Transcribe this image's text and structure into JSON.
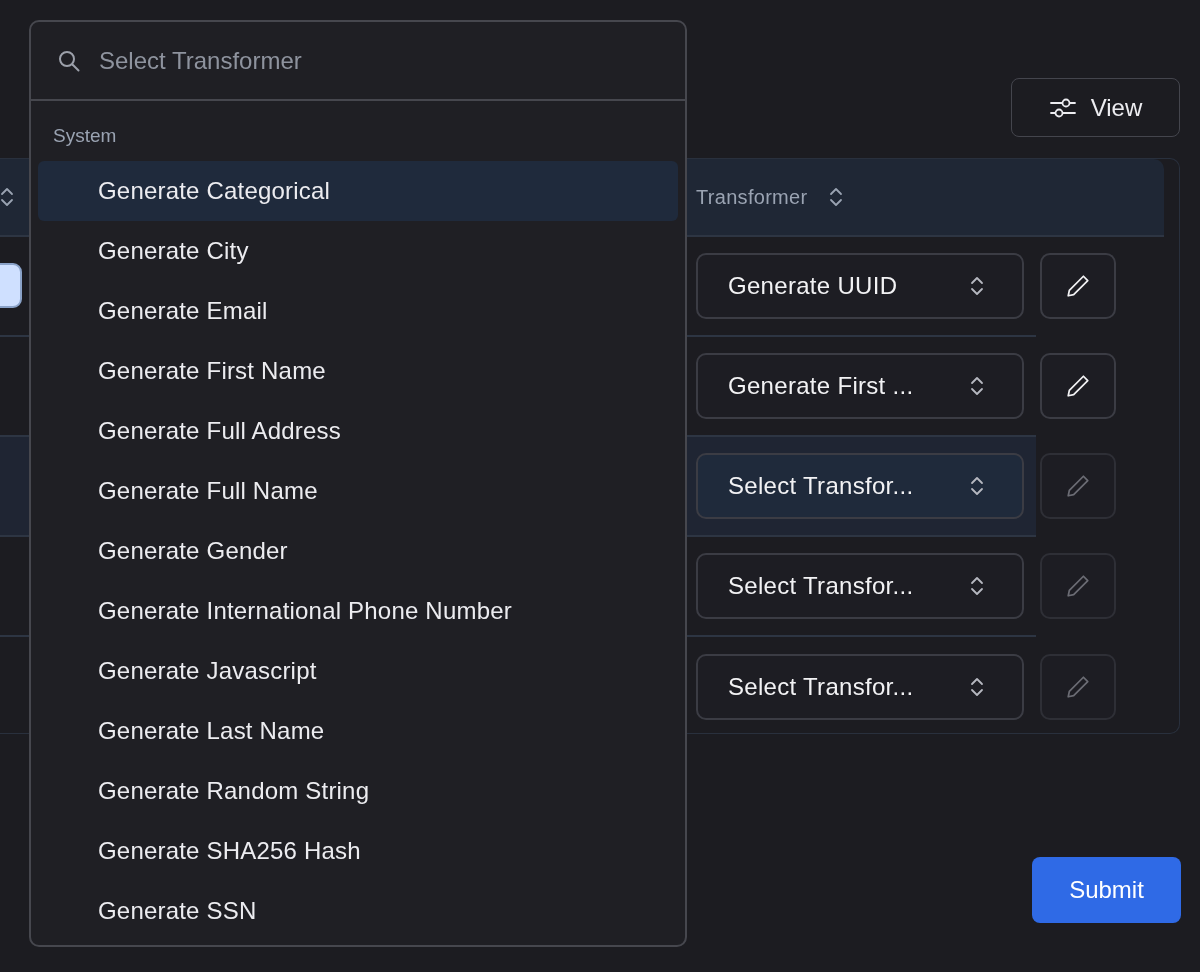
{
  "view_button": {
    "label": "View"
  },
  "table": {
    "column_header": "Transformer",
    "rows": [
      {
        "partial_button": true,
        "highlighted": false,
        "transformer": "Generate UUID",
        "edit_disabled": false
      },
      {
        "partial_button": false,
        "highlighted": false,
        "transformer": "Generate First ...",
        "edit_disabled": false
      },
      {
        "partial_button": false,
        "highlighted": true,
        "transformer": "Select Transfor...",
        "edit_disabled": true
      },
      {
        "partial_button": false,
        "highlighted": false,
        "transformer": "Select Transfor...",
        "edit_disabled": true
      },
      {
        "partial_button": false,
        "highlighted": false,
        "transformer": "Select Transfor...",
        "edit_disabled": true
      }
    ]
  },
  "submit_button": {
    "label": "Submit"
  },
  "transformer_menu": {
    "search": {
      "placeholder": "Select Transformer"
    },
    "group": "System",
    "items": [
      {
        "label": "Generate Categorical",
        "selected": true
      },
      {
        "label": "Generate City",
        "selected": false
      },
      {
        "label": "Generate Email",
        "selected": false
      },
      {
        "label": "Generate First Name",
        "selected": false
      },
      {
        "label": "Generate Full Address",
        "selected": false
      },
      {
        "label": "Generate Full Name",
        "selected": false
      },
      {
        "label": "Generate Gender",
        "selected": false
      },
      {
        "label": "Generate International Phone Number",
        "selected": false
      },
      {
        "label": "Generate Javascript",
        "selected": false
      },
      {
        "label": "Generate Last Name",
        "selected": false
      },
      {
        "label": "Generate Random String",
        "selected": false
      },
      {
        "label": "Generate SHA256 Hash",
        "selected": false
      },
      {
        "label": "Generate SSN",
        "selected": false
      }
    ]
  }
}
